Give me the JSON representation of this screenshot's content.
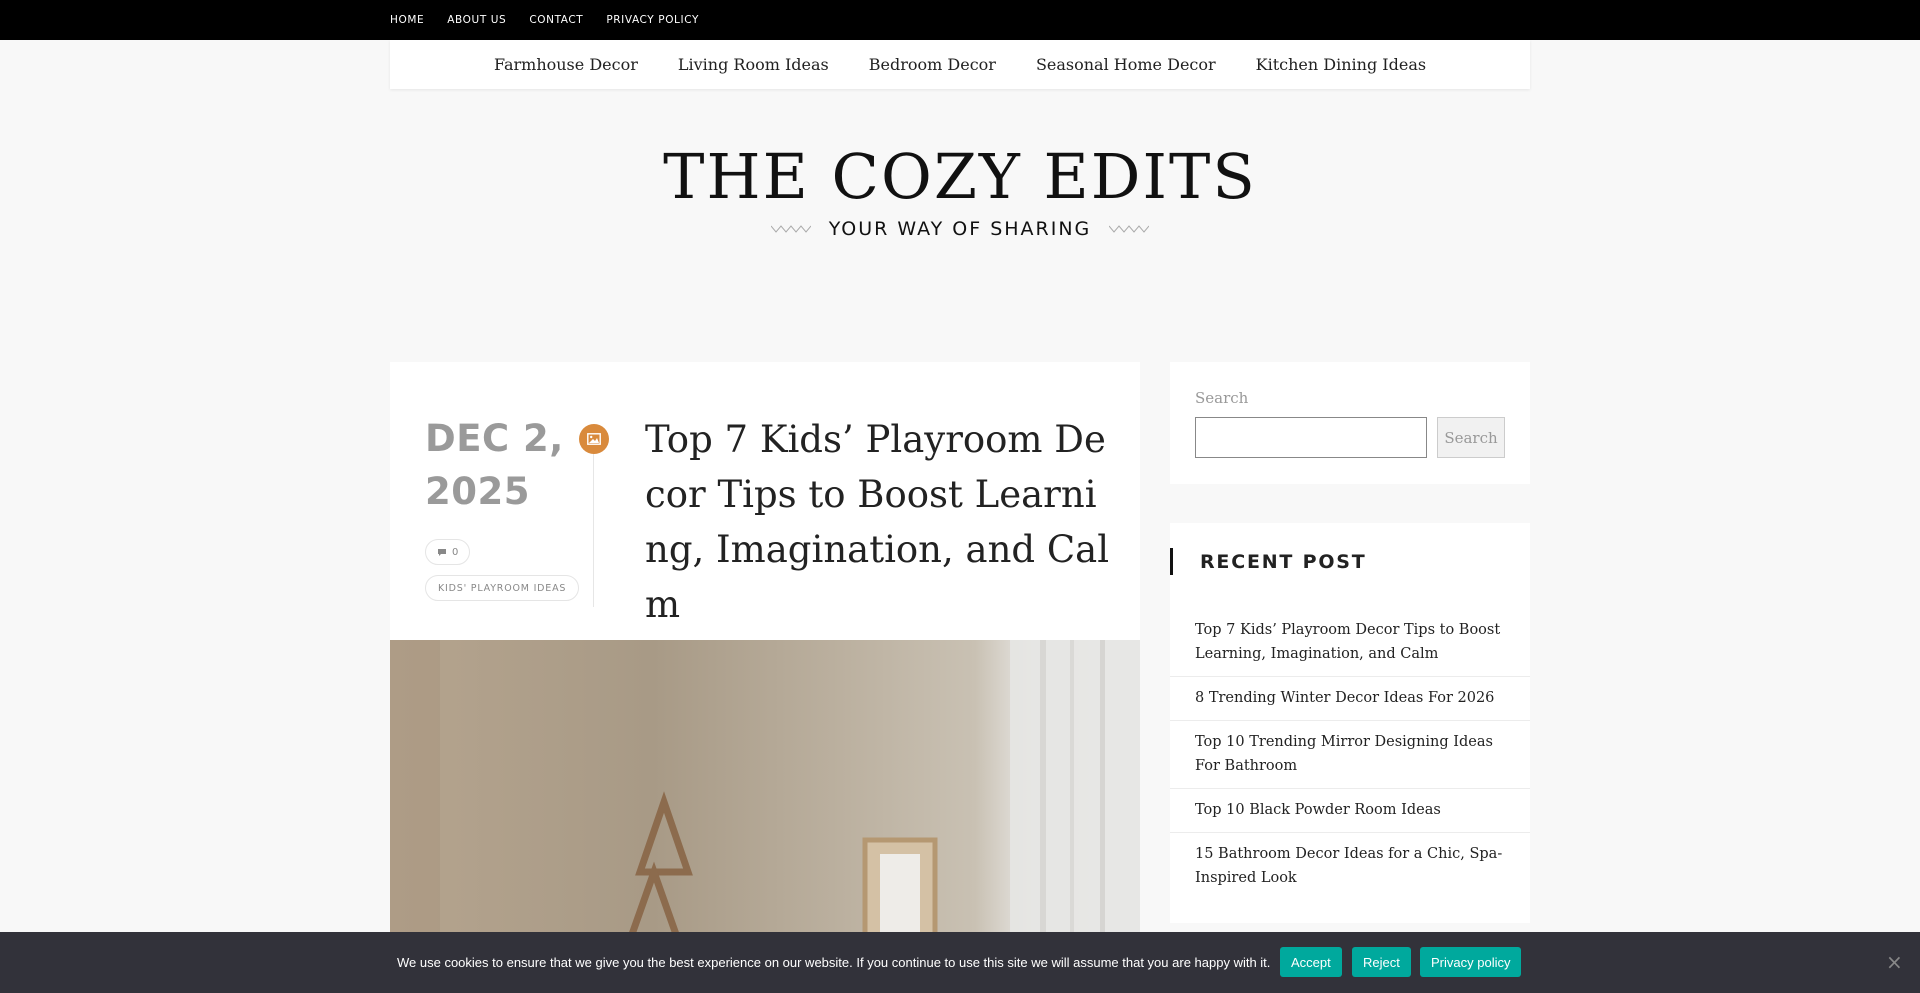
{
  "topbar": {
    "links": [
      "HOME",
      "ABOUT US",
      "CONTACT",
      "PRIVACY POLICY"
    ]
  },
  "mainnav": {
    "links": [
      "Farmhouse Decor",
      "Living Room Ideas",
      "Bedroom Decor",
      "Seasonal Home Decor",
      "Kitchen Dining Ideas"
    ]
  },
  "brand": {
    "title": "THE COZY EDITS",
    "tagline": "YOUR WAY OF SHARING"
  },
  "post": {
    "date_line1": "DEC 2,",
    "date_line2": "2025",
    "comments": "0",
    "category": "KIDS' PLAYROOM IDEAS",
    "title": "Top 7 Kids’ Playroom Decor Tips to Boost Learning, Imagination, and Calm",
    "format_icon": "image-icon"
  },
  "sidebar": {
    "search_label": "Search",
    "search_button": "Search",
    "recent_heading": "RECENT POST",
    "recent_posts": [
      "Top 7 Kids’ Playroom Decor Tips to Boost Learning, Imagination, and Calm",
      "8 Trending Winter Decor Ideas For 2026",
      "Top 10 Trending Mirror Designing Ideas For Bathroom",
      "Top 10 Black Powder Room Ideas",
      "15 Bathroom Decor Ideas for a Chic, Spa-Inspired Look"
    ]
  },
  "cookie": {
    "text": "We use cookies to ensure that we give you the best experience on our website. If you continue to use this site we will assume that you are happy with it.",
    "accept": "Accept",
    "reject": "Reject",
    "policy": "Privacy policy",
    "close": "×"
  },
  "colors": {
    "accent_orange": "#d98a3c",
    "cookie_button": "#00a99d",
    "cookie_bar": "#32323a"
  }
}
